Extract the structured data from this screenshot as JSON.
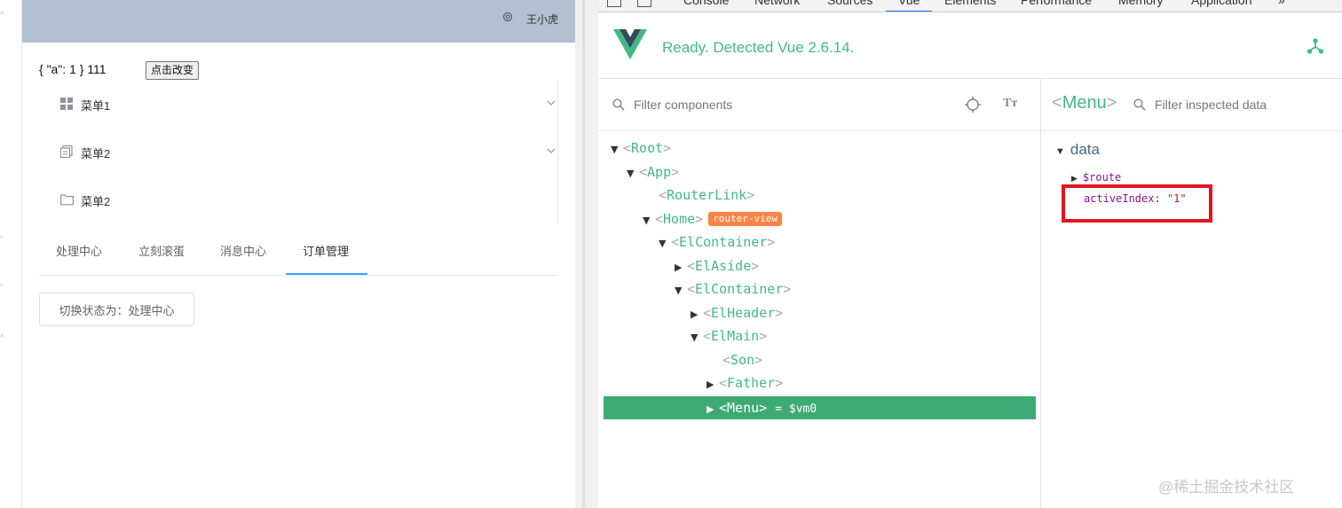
{
  "app": {
    "username": "王小虎",
    "json_text": "{ \"a\": 1 } 111",
    "change_button": "点击改变",
    "menu": [
      {
        "label": "菜单1",
        "icon": "grid-icon",
        "has_arrow": true
      },
      {
        "label": "菜单2",
        "icon": "document-icon",
        "has_arrow": true
      },
      {
        "label": "菜单2",
        "icon": "folder-icon",
        "has_arrow": false
      }
    ],
    "tabs": [
      "处理中心",
      "立刻滚蛋",
      "消息中心",
      "订单管理"
    ],
    "active_tab": "订单管理",
    "switch_button": "切换状态为：处理中心"
  },
  "devtools": {
    "tabs": [
      "Console",
      "Network",
      "Sources",
      "Vue",
      "Elements",
      "Performance",
      "Memory",
      "Application",
      "»"
    ],
    "active_tab": "Vue",
    "ready_text": "Ready. Detected Vue 2.6.14.",
    "filter_placeholder": "Filter components",
    "tree": [
      {
        "name": "Root",
        "expanded": true
      },
      {
        "name": "App",
        "expanded": true
      },
      {
        "name": "RouterLink"
      },
      {
        "name": "Home",
        "expanded": true,
        "badge": "router-view"
      },
      {
        "name": "ElContainer",
        "expanded": true
      },
      {
        "name": "ElAside",
        "expanded": false
      },
      {
        "name": "ElContainer",
        "expanded": true
      },
      {
        "name": "ElHeader",
        "expanded": false
      },
      {
        "name": "ElMain",
        "expanded": true
      },
      {
        "name": "Son"
      },
      {
        "name": "Father",
        "expanded": false
      },
      {
        "name": "Menu",
        "expanded": false,
        "selected": true,
        "vm": "= $vm0"
      }
    ],
    "inspector": {
      "title": "Menu",
      "filter_placeholder": "Filter inspected data",
      "section": "data",
      "route_key": "$route",
      "active_key": "activeIndex",
      "active_value": "\"1\""
    },
    "accent_color": "#42b983",
    "highlight_color": "#e3161f"
  },
  "watermark": "@稀土掘金技术社区"
}
